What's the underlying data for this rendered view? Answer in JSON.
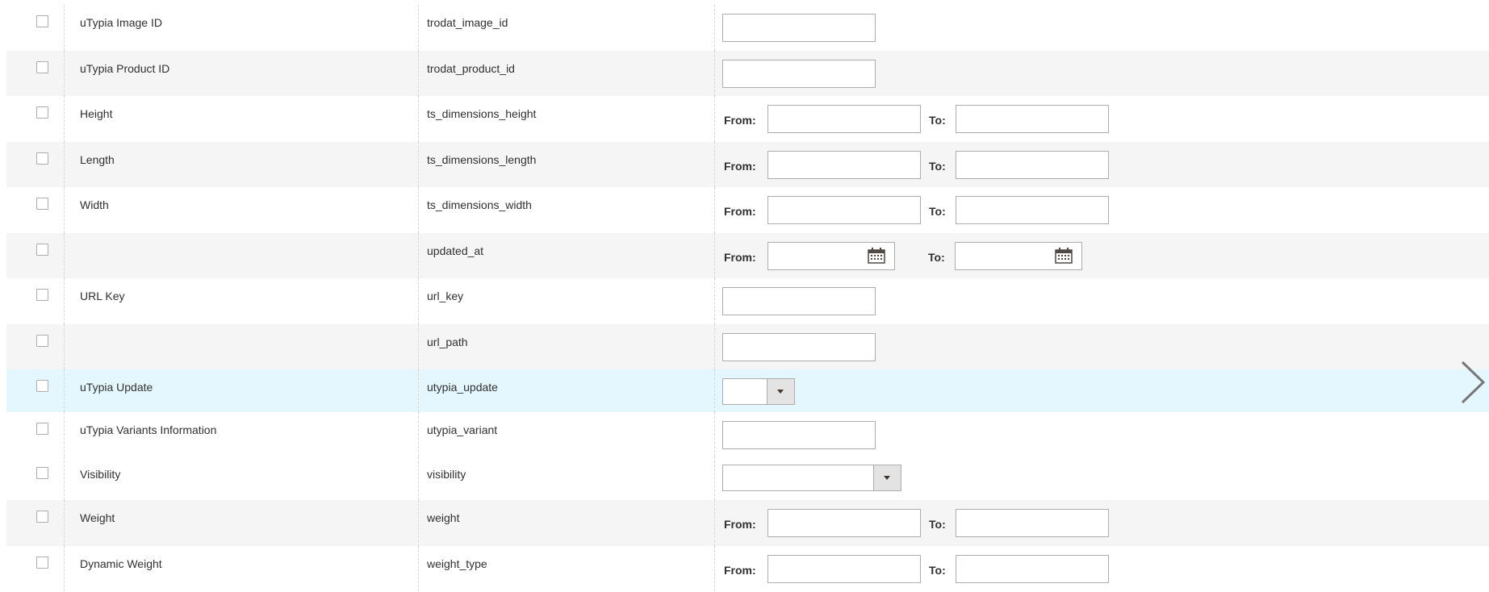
{
  "labels": {
    "from": "From:",
    "to": "To:"
  },
  "rows": [
    {
      "label": "uTypia Image ID",
      "code": "trodat_image_id",
      "filter": "text"
    },
    {
      "label": "uTypia Product ID",
      "code": "trodat_product_id",
      "filter": "text"
    },
    {
      "label": "Height",
      "code": "ts_dimensions_height",
      "filter": "range"
    },
    {
      "label": "Length",
      "code": "ts_dimensions_length",
      "filter": "range"
    },
    {
      "label": "Width",
      "code": "ts_dimensions_width",
      "filter": "range"
    },
    {
      "label": "",
      "code": "updated_at",
      "filter": "date-range"
    },
    {
      "label": "URL Key",
      "code": "url_key",
      "filter": "text"
    },
    {
      "label": "",
      "code": "url_path",
      "filter": "text"
    },
    {
      "label": "uTypia Update",
      "code": "utypia_update",
      "filter": "select-small"
    },
    {
      "label": "uTypia Variants Information",
      "code": "utypia_variant",
      "filter": "text"
    },
    {
      "label": "Visibility",
      "code": "visibility",
      "filter": "select-big"
    },
    {
      "label": "Weight",
      "code": "weight",
      "filter": "range"
    },
    {
      "label": "Dynamic Weight",
      "code": "weight_type",
      "filter": "range"
    }
  ],
  "icons": {
    "calendar": "calendar-icon",
    "next": "chevron-right-icon"
  }
}
